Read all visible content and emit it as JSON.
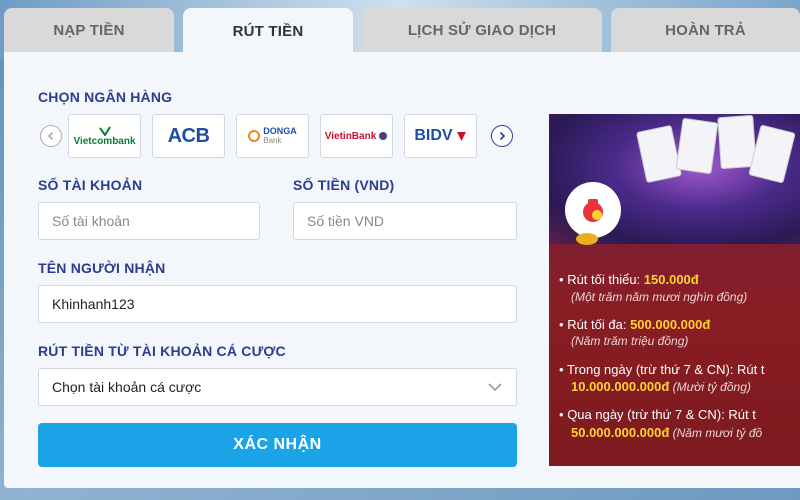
{
  "tabs": [
    {
      "label": "NẠP TIỀN",
      "active": false
    },
    {
      "label": "RÚT TIỀN",
      "active": true
    },
    {
      "label": "LỊCH SỬ GIAO DỊCH",
      "active": false
    },
    {
      "label": "HOÀN TRẢ",
      "active": false
    }
  ],
  "form": {
    "bank_label": "CHỌN NGÂN HÀNG",
    "banks": [
      {
        "name": "Vietcombank",
        "color": "#0f7a3a"
      },
      {
        "name": "ACB",
        "color": "#1e4fa8"
      },
      {
        "name": "DONGA",
        "sub": "Bank",
        "color": "#e8891a"
      },
      {
        "name": "VietinBank",
        "color": "#c8102e"
      },
      {
        "name": "BIDV",
        "color": "#1e4fa8"
      }
    ],
    "account_label": "SỐ TÀI KHOẢN",
    "account_placeholder": "Số tài khoản",
    "amount_label": "SỐ TIỀN (VND)",
    "amount_placeholder": "Số tiền VND",
    "recipient_label": "TÊN NGƯỜI NHẬN",
    "recipient_value": "Khinhanh123",
    "source_label": "RÚT TIỀN TỪ TÀI KHOẢN CÁ CƯỢC",
    "source_value": "Chọn tài khoản cá cược",
    "submit_label": "XÁC NHẬN"
  },
  "promo": {
    "min_label": "Rút tối thiểu: ",
    "min_value": "150.000đ",
    "min_words": "(Một trăm năm mươi nghìn đồng)",
    "max_label": "Rút tối đa: ",
    "max_value": "500.000.000đ",
    "max_words": "(Năm trăm triệu đồng)",
    "day_label": "Trong ngày (trừ thứ 7 & CN): Rút t",
    "day_value": "10.000.000.000đ",
    "day_words": " (Mười tỷ đồng)",
    "overnight_label": "Qua ngày (trừ thứ 7 & CN): Rút t",
    "overnight_value": "50.000.000.000đ",
    "overnight_words": " (Năm mươi tỷ đồ"
  },
  "colors": {
    "accent": "#1ba3e8",
    "label": "#2a3d8f",
    "promo_highlight": "#ffd22e"
  }
}
